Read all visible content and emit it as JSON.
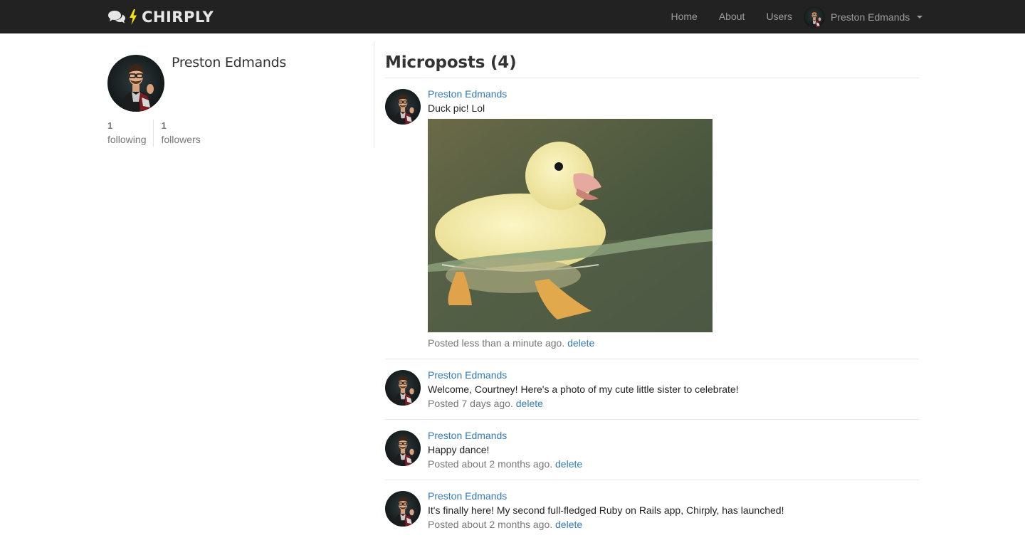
{
  "navbar": {
    "brand": "CHIRPLY",
    "links": [
      "Home",
      "About",
      "Users"
    ],
    "user_name": "Preston Edmands"
  },
  "profile": {
    "name": "Preston Edmands",
    "following_count": "1",
    "following_label": "following",
    "followers_count": "1",
    "followers_label": "followers"
  },
  "microposts": {
    "heading": "Microposts (4)",
    "items": [
      {
        "user": "Preston Edmands",
        "content": "Duck pic! Lol",
        "posted": "Posted less than a minute ago.",
        "delete": "delete"
      },
      {
        "user": "Preston Edmands",
        "content": "Welcome, Courtney! Here's a photo of my cute little sister to celebrate!",
        "posted": "Posted 7 days ago.",
        "delete": "delete"
      },
      {
        "user": "Preston Edmands",
        "content": "Happy dance!",
        "posted": "Posted about 2 months ago.",
        "delete": "delete"
      },
      {
        "user": "Preston Edmands",
        "content": "It's finally here! My second full-fledged Ruby on Rails app, Chirply, has launched!",
        "posted": "Posted about 2 months ago.",
        "delete": "delete"
      }
    ]
  },
  "colors": {
    "navbar_bg": "#222222",
    "link": "#337ab7",
    "muted": "#777777",
    "bolt": "#f5e60a"
  },
  "icons": {
    "brand_chat": "chat-bubbles-icon",
    "brand_bolt": "lightning-bolt-icon",
    "dropdown": "caret-down-icon"
  }
}
